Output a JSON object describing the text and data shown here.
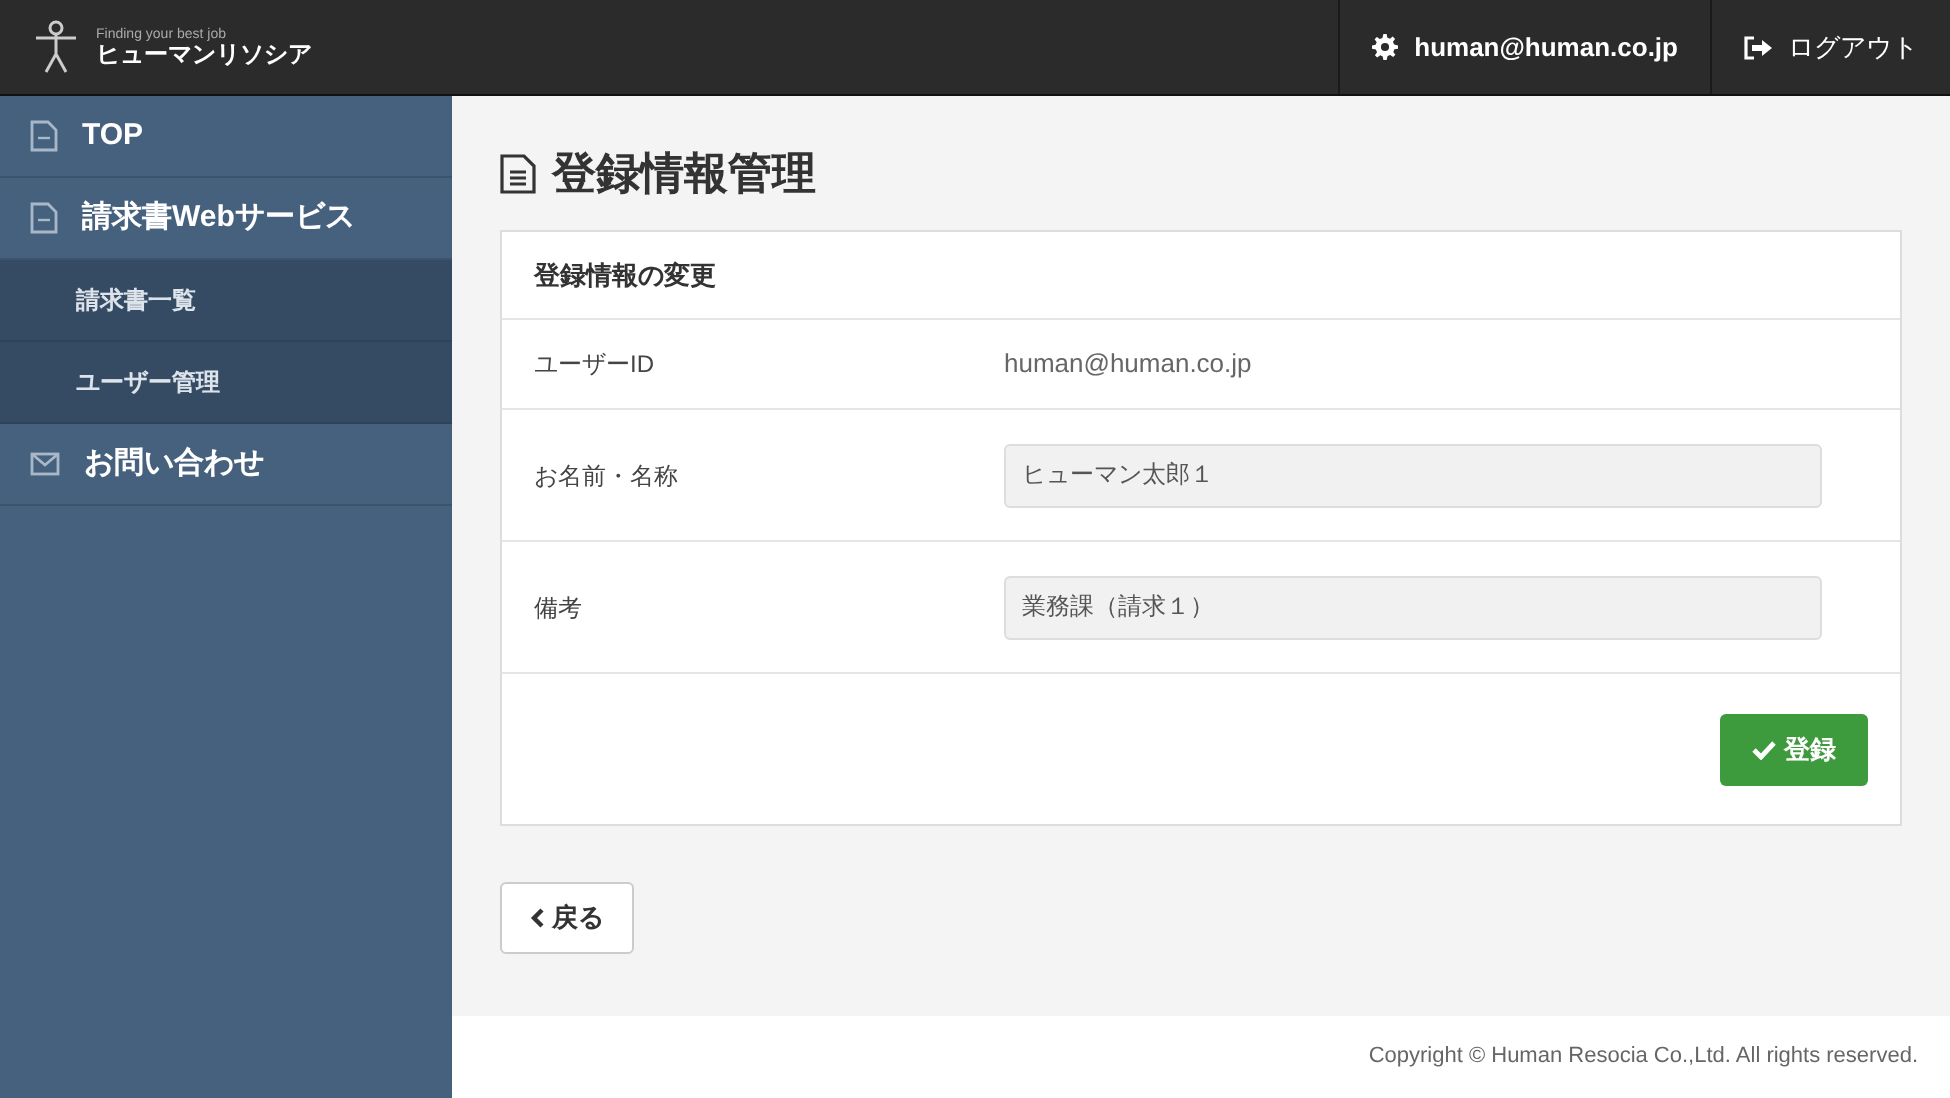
{
  "header": {
    "logo_tagline": "Finding your best job",
    "logo_name": "ヒューマンリソシア",
    "user": "human@human.co.jp",
    "logout": "ログアウト"
  },
  "sidebar": {
    "items": [
      {
        "label": "TOP",
        "kind": "page"
      },
      {
        "label": "請求書Webサービス",
        "kind": "page"
      },
      {
        "label": "請求書一覧",
        "kind": "sub"
      },
      {
        "label": "ユーザー管理",
        "kind": "sub"
      },
      {
        "label": "お問い合わせ",
        "kind": "contact"
      }
    ]
  },
  "page_title": "登録情報管理",
  "panel": {
    "title": "登録情報の変更",
    "rows": [
      {
        "label": "ユーザーID",
        "kind": "text",
        "value": "human@human.co.jp"
      },
      {
        "label": "お名前・名称",
        "kind": "input",
        "value": "ヒューマン太郎１"
      },
      {
        "label": "備考",
        "kind": "input",
        "value": "業務課（請求１）"
      }
    ],
    "submit": "登録"
  },
  "back_button": "戻る",
  "footer": "Copyright © Human Resocia Co.,Ltd. All rights reserved."
}
